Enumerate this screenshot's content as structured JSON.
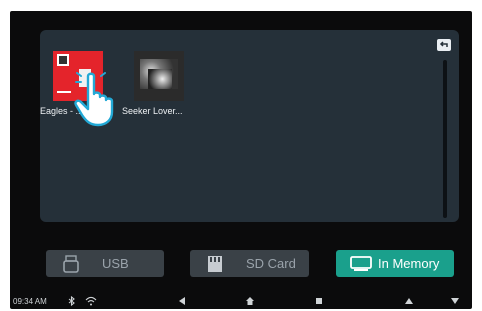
{
  "files": [
    {
      "name": "Eagles - ...",
      "thumbnail_icon": "album-cover-red-icon"
    },
    {
      "name": "Seeker Lover...",
      "thumbnail_icon": "album-cover-gray-icon"
    }
  ],
  "back_icon": "back-arrow-icon",
  "sources": [
    {
      "label": "USB",
      "icon": "usb-icon",
      "active": false
    },
    {
      "label": "SD Card",
      "icon": "sd-card-icon",
      "active": false
    },
    {
      "label": "In Memory",
      "icon": "memory-icon",
      "active": true
    }
  ],
  "status_bar": {
    "time": "09:34 AM",
    "icons": [
      "bluetooth-icon",
      "wifi-icon"
    ]
  },
  "nav_bar": [
    "back-nav-icon",
    "home-icon",
    "recent-apps-icon",
    "volume-up-icon",
    "volume-down-icon"
  ],
  "colors": {
    "background": "#0b0b0c",
    "panel": "#253039",
    "button": "#3a4147",
    "active_button": "#1aa08c"
  }
}
